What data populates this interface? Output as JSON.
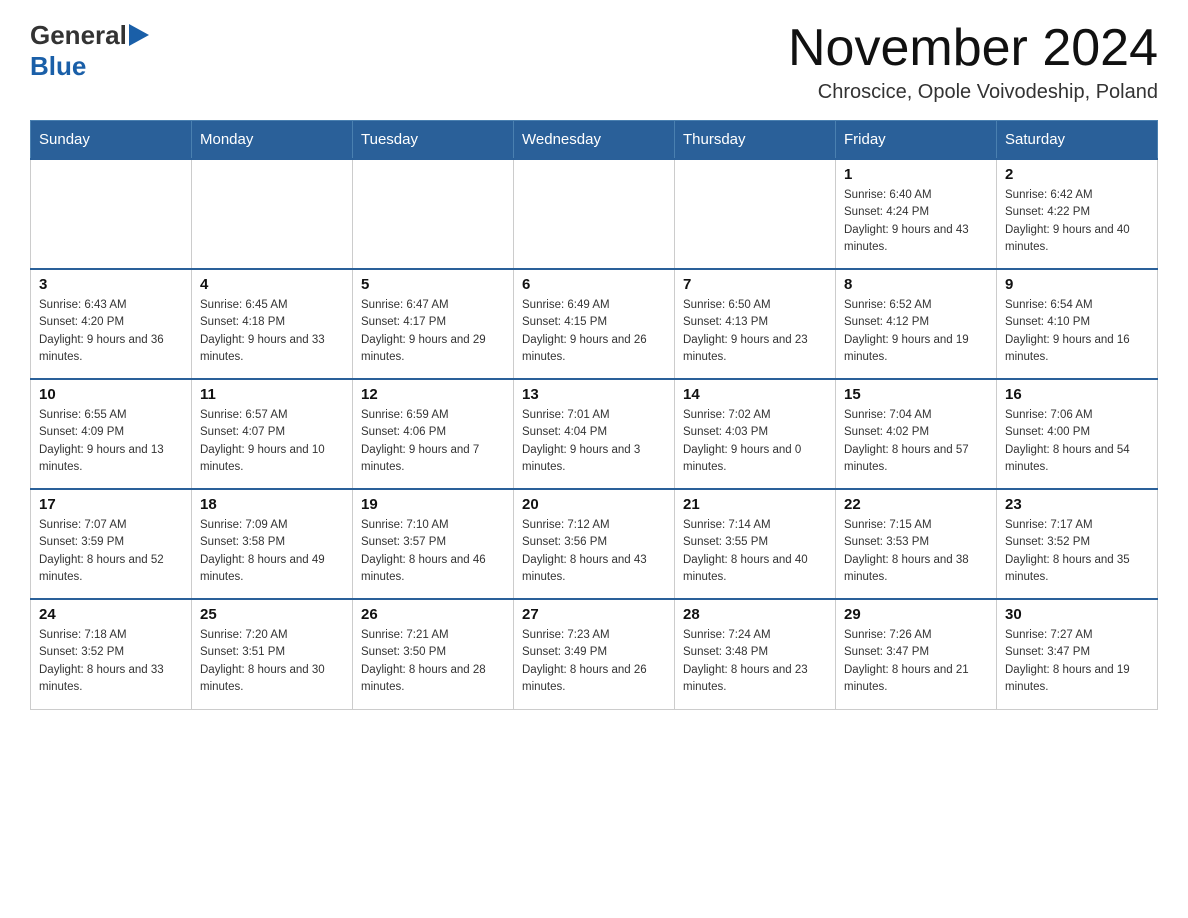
{
  "header": {
    "logo_general": "General",
    "logo_blue": "Blue",
    "title": "November 2024",
    "subtitle": "Chroscice, Opole Voivodeship, Poland"
  },
  "days_of_week": [
    "Sunday",
    "Monday",
    "Tuesday",
    "Wednesday",
    "Thursday",
    "Friday",
    "Saturday"
  ],
  "weeks": [
    [
      {
        "day": "",
        "info": ""
      },
      {
        "day": "",
        "info": ""
      },
      {
        "day": "",
        "info": ""
      },
      {
        "day": "",
        "info": ""
      },
      {
        "day": "",
        "info": ""
      },
      {
        "day": "1",
        "info": "Sunrise: 6:40 AM\nSunset: 4:24 PM\nDaylight: 9 hours and 43 minutes."
      },
      {
        "day": "2",
        "info": "Sunrise: 6:42 AM\nSunset: 4:22 PM\nDaylight: 9 hours and 40 minutes."
      }
    ],
    [
      {
        "day": "3",
        "info": "Sunrise: 6:43 AM\nSunset: 4:20 PM\nDaylight: 9 hours and 36 minutes."
      },
      {
        "day": "4",
        "info": "Sunrise: 6:45 AM\nSunset: 4:18 PM\nDaylight: 9 hours and 33 minutes."
      },
      {
        "day": "5",
        "info": "Sunrise: 6:47 AM\nSunset: 4:17 PM\nDaylight: 9 hours and 29 minutes."
      },
      {
        "day": "6",
        "info": "Sunrise: 6:49 AM\nSunset: 4:15 PM\nDaylight: 9 hours and 26 minutes."
      },
      {
        "day": "7",
        "info": "Sunrise: 6:50 AM\nSunset: 4:13 PM\nDaylight: 9 hours and 23 minutes."
      },
      {
        "day": "8",
        "info": "Sunrise: 6:52 AM\nSunset: 4:12 PM\nDaylight: 9 hours and 19 minutes."
      },
      {
        "day": "9",
        "info": "Sunrise: 6:54 AM\nSunset: 4:10 PM\nDaylight: 9 hours and 16 minutes."
      }
    ],
    [
      {
        "day": "10",
        "info": "Sunrise: 6:55 AM\nSunset: 4:09 PM\nDaylight: 9 hours and 13 minutes."
      },
      {
        "day": "11",
        "info": "Sunrise: 6:57 AM\nSunset: 4:07 PM\nDaylight: 9 hours and 10 minutes."
      },
      {
        "day": "12",
        "info": "Sunrise: 6:59 AM\nSunset: 4:06 PM\nDaylight: 9 hours and 7 minutes."
      },
      {
        "day": "13",
        "info": "Sunrise: 7:01 AM\nSunset: 4:04 PM\nDaylight: 9 hours and 3 minutes."
      },
      {
        "day": "14",
        "info": "Sunrise: 7:02 AM\nSunset: 4:03 PM\nDaylight: 9 hours and 0 minutes."
      },
      {
        "day": "15",
        "info": "Sunrise: 7:04 AM\nSunset: 4:02 PM\nDaylight: 8 hours and 57 minutes."
      },
      {
        "day": "16",
        "info": "Sunrise: 7:06 AM\nSunset: 4:00 PM\nDaylight: 8 hours and 54 minutes."
      }
    ],
    [
      {
        "day": "17",
        "info": "Sunrise: 7:07 AM\nSunset: 3:59 PM\nDaylight: 8 hours and 52 minutes."
      },
      {
        "day": "18",
        "info": "Sunrise: 7:09 AM\nSunset: 3:58 PM\nDaylight: 8 hours and 49 minutes."
      },
      {
        "day": "19",
        "info": "Sunrise: 7:10 AM\nSunset: 3:57 PM\nDaylight: 8 hours and 46 minutes."
      },
      {
        "day": "20",
        "info": "Sunrise: 7:12 AM\nSunset: 3:56 PM\nDaylight: 8 hours and 43 minutes."
      },
      {
        "day": "21",
        "info": "Sunrise: 7:14 AM\nSunset: 3:55 PM\nDaylight: 8 hours and 40 minutes."
      },
      {
        "day": "22",
        "info": "Sunrise: 7:15 AM\nSunset: 3:53 PM\nDaylight: 8 hours and 38 minutes."
      },
      {
        "day": "23",
        "info": "Sunrise: 7:17 AM\nSunset: 3:52 PM\nDaylight: 8 hours and 35 minutes."
      }
    ],
    [
      {
        "day": "24",
        "info": "Sunrise: 7:18 AM\nSunset: 3:52 PM\nDaylight: 8 hours and 33 minutes."
      },
      {
        "day": "25",
        "info": "Sunrise: 7:20 AM\nSunset: 3:51 PM\nDaylight: 8 hours and 30 minutes."
      },
      {
        "day": "26",
        "info": "Sunrise: 7:21 AM\nSunset: 3:50 PM\nDaylight: 8 hours and 28 minutes."
      },
      {
        "day": "27",
        "info": "Sunrise: 7:23 AM\nSunset: 3:49 PM\nDaylight: 8 hours and 26 minutes."
      },
      {
        "day": "28",
        "info": "Sunrise: 7:24 AM\nSunset: 3:48 PM\nDaylight: 8 hours and 23 minutes."
      },
      {
        "day": "29",
        "info": "Sunrise: 7:26 AM\nSunset: 3:47 PM\nDaylight: 8 hours and 21 minutes."
      },
      {
        "day": "30",
        "info": "Sunrise: 7:27 AM\nSunset: 3:47 PM\nDaylight: 8 hours and 19 minutes."
      }
    ]
  ]
}
